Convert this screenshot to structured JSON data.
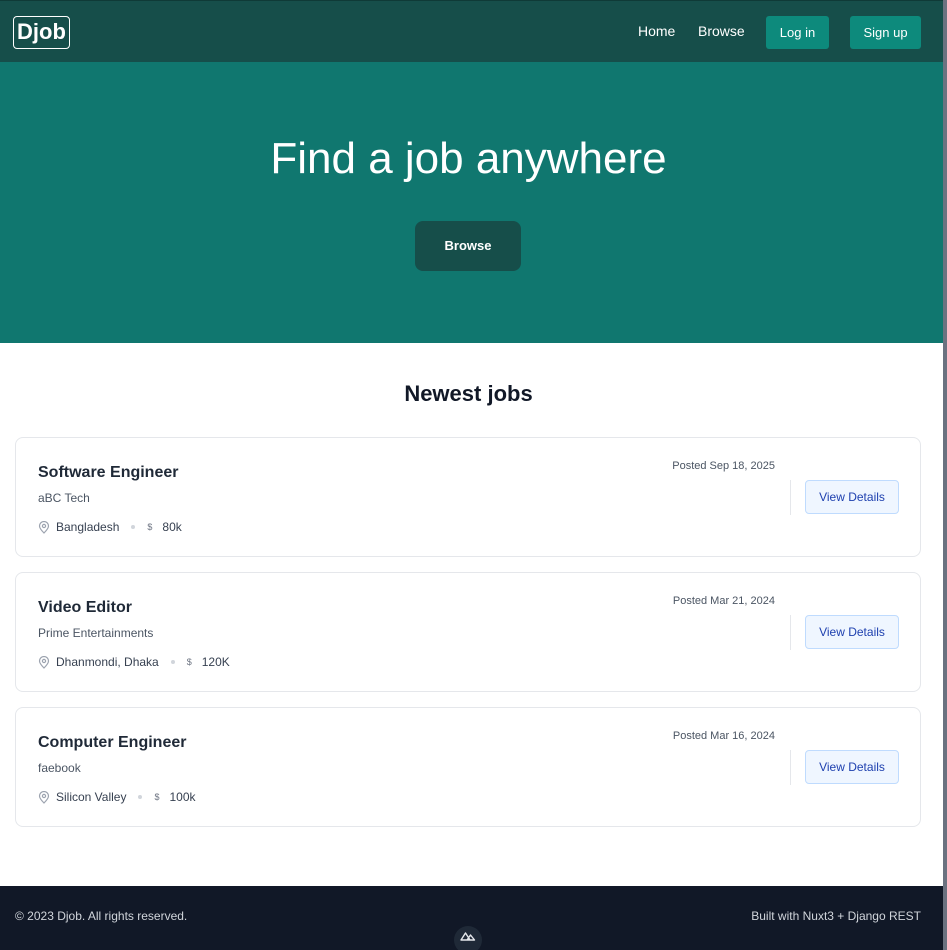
{
  "nav": {
    "logo": "Djob",
    "home": "Home",
    "browse": "Browse",
    "login": "Log in",
    "signup": "Sign up"
  },
  "hero": {
    "title": "Find a job anywhere",
    "button": "Browse"
  },
  "jobs": {
    "section_title": "Newest jobs",
    "details_label": "View Details",
    "items": [
      {
        "title": "Software Engineer",
        "company": "aBC Tech",
        "location": "Bangladesh",
        "salary": "80k",
        "posted": "Posted Sep 18, 2025"
      },
      {
        "title": "Video Editor",
        "company": "Prime Entertainments",
        "location": "Dhanmondi, Dhaka",
        "salary": "120K",
        "posted": "Posted Mar 21, 2024"
      },
      {
        "title": "Computer Engineer",
        "company": "faebook",
        "location": "Silicon Valley",
        "salary": "100k",
        "posted": "Posted Mar 16, 2024"
      }
    ]
  },
  "footer": {
    "copyright": "© 2023 Djob. All rights reserved.",
    "built_with": "Built with Nuxt3 + Django REST"
  },
  "colors": {
    "nav_bg": "#164e4a",
    "hero_bg": "#10776f",
    "accent": "#0d8a7c",
    "footer_bg": "#111827"
  }
}
